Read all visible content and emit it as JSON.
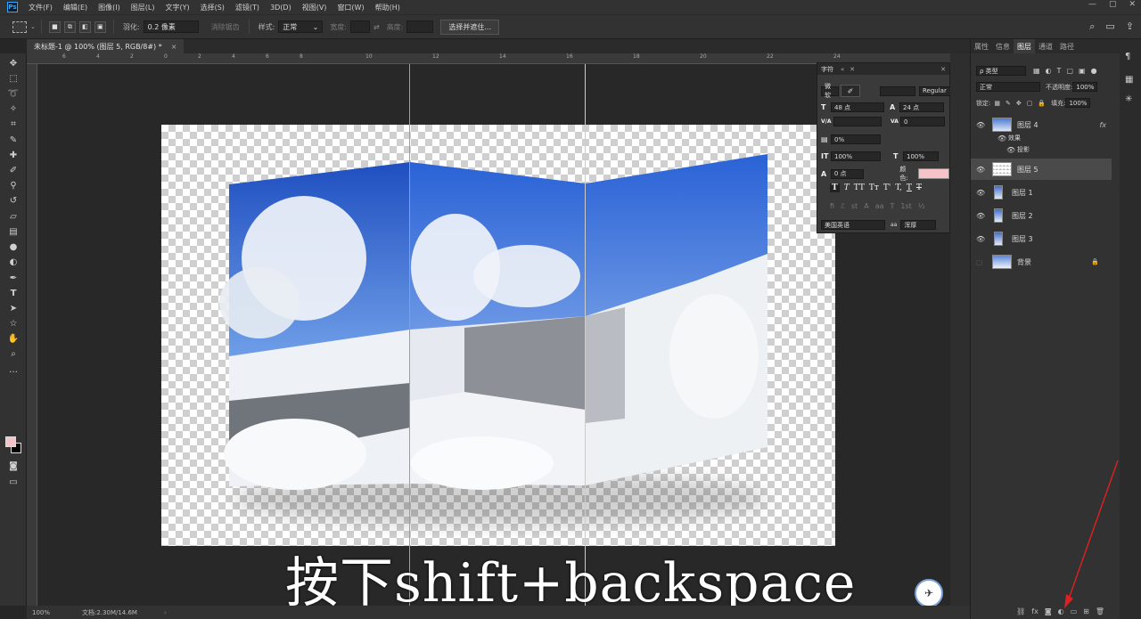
{
  "app": {
    "logo": "Ps"
  },
  "menu": [
    "文件(F)",
    "编辑(E)",
    "图像(I)",
    "图层(L)",
    "文字(Y)",
    "选择(S)",
    "滤镜(T)",
    "3D(D)",
    "视图(V)",
    "窗口(W)",
    "帮助(H)"
  ],
  "window_controls": [
    "—",
    "▢",
    "✕"
  ],
  "options": {
    "feather_label": "羽化:",
    "feather_value": "0.2 像素",
    "antialias_label": "消除锯齿",
    "style_label": "样式:",
    "style_value": "正常",
    "width_label": "宽度:",
    "height_label": "高度:",
    "select_mask_button": "选择并遮住..."
  },
  "document_tab": {
    "title": "未标题-1 @ 100% (图层 5, RGB/8#) *",
    "close": "×"
  },
  "ruler_ticks": [
    "6",
    "4",
    "2",
    "0",
    "2",
    "4",
    "6",
    "8",
    "10",
    "12",
    "14",
    "16",
    "18",
    "20",
    "22",
    "24"
  ],
  "status": {
    "zoom": "100%",
    "doc": "文档:2.30M/14.6M"
  },
  "caption": "按下shift+backspace",
  "character_panel": {
    "tab": "字符",
    "font_family": "微软",
    "font_style": "Regular",
    "font_size": "48 点",
    "leading": "24 点",
    "kerning_label": "V/A",
    "tracking": "0",
    "scale_percent": "0%",
    "vertical_scale": "100%",
    "horizontal_scale": "100%",
    "baseline_shift": "0 点",
    "color_label": "颜色:",
    "color": "#f4c4c8",
    "language": "美国英语",
    "aa_label": "aa",
    "aa_method": "浑厚"
  },
  "layers_panel": {
    "tabs": [
      "属性",
      "信息",
      "图层",
      "通道",
      "路径"
    ],
    "active_tab": "图层",
    "filter_kind": "ρ 类型",
    "blend_mode": "正常",
    "opacity_label": "不透明度:",
    "opacity_value": "100%",
    "lock_label": "锁定:",
    "fill_label": "填充:",
    "fill_value": "100%",
    "layers": [
      {
        "name": "图层 4",
        "fx": "fx"
      },
      {
        "name": "效果"
      },
      {
        "name": "投影"
      },
      {
        "name": "图层 5"
      },
      {
        "name": "图层 1"
      },
      {
        "name": "图层 2"
      },
      {
        "name": "图层 3"
      },
      {
        "name": "背景"
      }
    ]
  },
  "colors": {
    "foreground": "#f4c4c8",
    "background": "#000000",
    "guide": "#35c9d6"
  }
}
